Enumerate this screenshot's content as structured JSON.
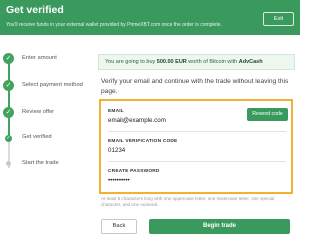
{
  "header": {
    "title": "Get verified",
    "subtitle": "You'll receive funds in your external wallet provided by PrimeXBT.com once the order is complete.",
    "exit_label": "Exit",
    "color": "#3a9a5e"
  },
  "steps": [
    {
      "label": "Enter amount",
      "state": "done",
      "icon": "check-icon"
    },
    {
      "label": "Select payment method",
      "state": "done",
      "icon": "check-icon"
    },
    {
      "label": "Review offer",
      "state": "done",
      "icon": "check-icon"
    },
    {
      "label": "Get verified",
      "state": "current",
      "icon": "check-icon"
    },
    {
      "label": "Start the trade",
      "state": "todo",
      "icon": "dot-icon"
    }
  ],
  "notice": {
    "prefix": "You are going to buy",
    "amount": "500.00 EUR",
    "middle": "worth of Bitcoin with",
    "provider": "AdvCash"
  },
  "instructions": "Verify your email and continue with the trade without leaving this page.",
  "form": {
    "highlight_color": "#f1b133",
    "email_label": "EMAIL",
    "email_value": "email@example.com",
    "resend_label": "Resend code",
    "code_label": "EMAIL VERIFICATION CODE",
    "code_value": "01234",
    "password_label": "CREATE PASSWORD",
    "password_value": "••••••••••"
  },
  "hint": "At least 8 characters long with one uppercase letter, one lowercase letter, one special character, and one numeral.",
  "buttons": {
    "back": "Back",
    "begin": "Begin trade"
  }
}
